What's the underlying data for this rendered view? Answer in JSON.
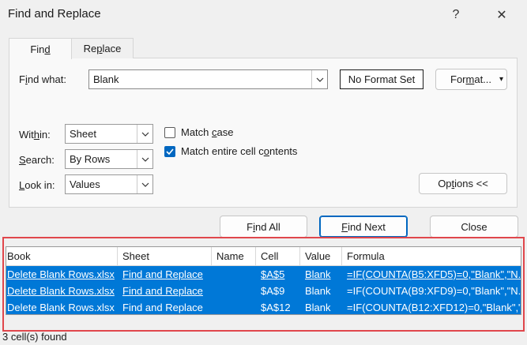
{
  "window": {
    "title": "Find and Replace",
    "help_glyph": "?",
    "close_glyph": "✕"
  },
  "tabs": [
    {
      "label_pre": "Fin",
      "accel": "d",
      "label_post": "",
      "active": true
    },
    {
      "label_pre": "Re",
      "accel": "p",
      "label_post": "lace",
      "active": false
    }
  ],
  "find_what": {
    "label_pre": "F",
    "accel": "i",
    "label_post": "nd what:",
    "value": "Blank"
  },
  "format": {
    "no_format_label": "No Format Set",
    "format_pre": "For",
    "format_accel": "m",
    "format_post": "at...",
    "format_arrow": "▾"
  },
  "options": {
    "within": {
      "label_pre": "Wit",
      "accel": "h",
      "label_post": "in:",
      "value": "Sheet"
    },
    "search": {
      "label_pre": "",
      "accel": "S",
      "label_post": "earch:",
      "value": "By Rows"
    },
    "look_in": {
      "label_pre": "",
      "accel": "L",
      "label_post": "ook in:",
      "value": "Values"
    },
    "match_case": {
      "label_pre": "Match ",
      "accel": "c",
      "label_post": "ase",
      "checked": false
    },
    "match_entire": {
      "label_pre": "Match entire cell c",
      "accel": "o",
      "label_post": "ntents",
      "checked": true
    },
    "options_button": {
      "label_pre": "Op",
      "accel": "t",
      "label_post": "ions <<"
    }
  },
  "actions": {
    "find_all": {
      "pre": "F",
      "accel": "i",
      "post": "nd All"
    },
    "find_next": {
      "pre": "",
      "accel": "F",
      "post": "ind Next"
    },
    "close": "Close"
  },
  "results": {
    "columns": [
      "Book",
      "Sheet",
      "Name",
      "Cell",
      "Value",
      "Formula"
    ],
    "rows": [
      {
        "book": "Delete Blank Rows.xlsx",
        "sheet": "Find and Replace",
        "name": "",
        "cell": "$A$5",
        "value": "Blank",
        "formula": "=IF(COUNTA(B5:XFD5)=0,\"Blank\",\"N..."
      },
      {
        "book": "Delete Blank Rows.xlsx",
        "sheet": "Find and Replace",
        "name": "",
        "cell": "$A$9",
        "value": "Blank",
        "formula": "=IF(COUNTA(B9:XFD9)=0,\"Blank\",\"N..."
      },
      {
        "book": "Delete Blank Rows.xlsx",
        "sheet": "Find and Replace",
        "name": "",
        "cell": "$A$12",
        "value": "Blank",
        "formula": "=IF(COUNTA(B12:XFD12)=0,\"Blank\",\"..."
      }
    ],
    "status": "3 cell(s) found"
  },
  "colors": {
    "selection": "#0078d7",
    "highlight_frame": "#e0474c",
    "checkbox": "#0067c0"
  }
}
